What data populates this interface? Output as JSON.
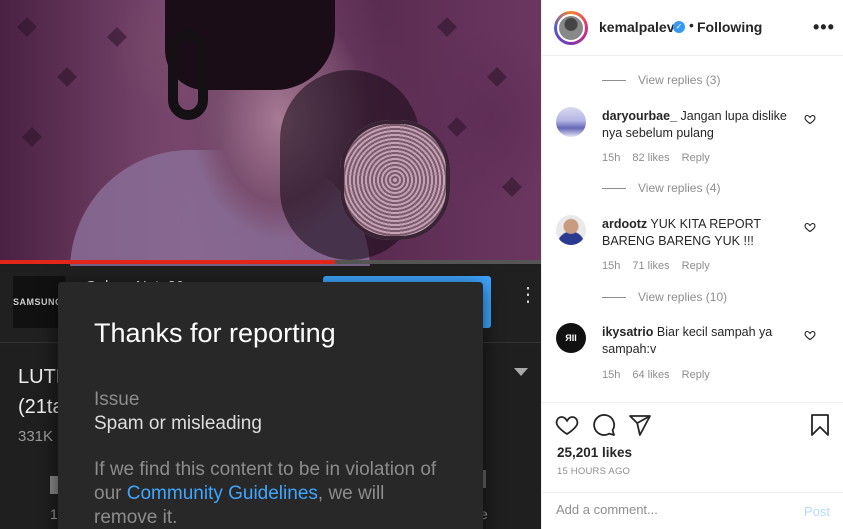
{
  "video": {
    "channel_logo_text": "SAMSUNG",
    "channel_name_fragment": "Galaxy Note20",
    "title_fragment_line1": "LUTI",
    "title_fragment_line2": "(21ta",
    "views_fragment": "331K",
    "like_fragment": "1",
    "right_fragment": "e",
    "progress_fraction": 0.62
  },
  "dialog": {
    "title": "Thanks for reporting",
    "issue_label": "Issue",
    "issue_value": "Spam or misleading",
    "body_prefix": "If we find this content to be in violation of our ",
    "body_link": "Community Guidelines",
    "body_suffix": ", we will remove it."
  },
  "instagram": {
    "header": {
      "username": "kemalpalevi",
      "verified": "✓",
      "separator": "•",
      "follow_status": "Following",
      "more": "•••"
    },
    "comments": [
      {
        "replies_label": "View replies (3)"
      },
      {
        "user": "daryourbae_",
        "text": "Jangan lupa dislike nya sebelum pulang",
        "time": "15h",
        "likes": "82 likes",
        "reply": "Reply",
        "replies_label": "View replies (4)"
      },
      {
        "user": "ardootz",
        "text": "YUK KITA REPORT BARENG BARENG YUK !!!",
        "time": "15h",
        "likes": "71 likes",
        "reply": "Reply",
        "replies_label": "View replies (10)"
      },
      {
        "user": "ikysatrio",
        "text": "Biar kecil sampah ya sampah:v",
        "time": "15h",
        "likes": "64 likes",
        "reply": "Reply",
        "avatar_text": "ЯΙΙ"
      }
    ],
    "likes_count": "25,201 likes",
    "timestamp": "15 HOURS AGO",
    "add_comment_placeholder": "Add a comment...",
    "post_label": "Post",
    "icons": [
      "heart-icon",
      "comment-icon",
      "share-icon",
      "bookmark-icon"
    ]
  },
  "colors": {
    "instagram_blue": "#3897f0",
    "youtube_link": "#3ea6ff",
    "youtube_red": "#e2261a",
    "dialog_bg": "#282828"
  }
}
